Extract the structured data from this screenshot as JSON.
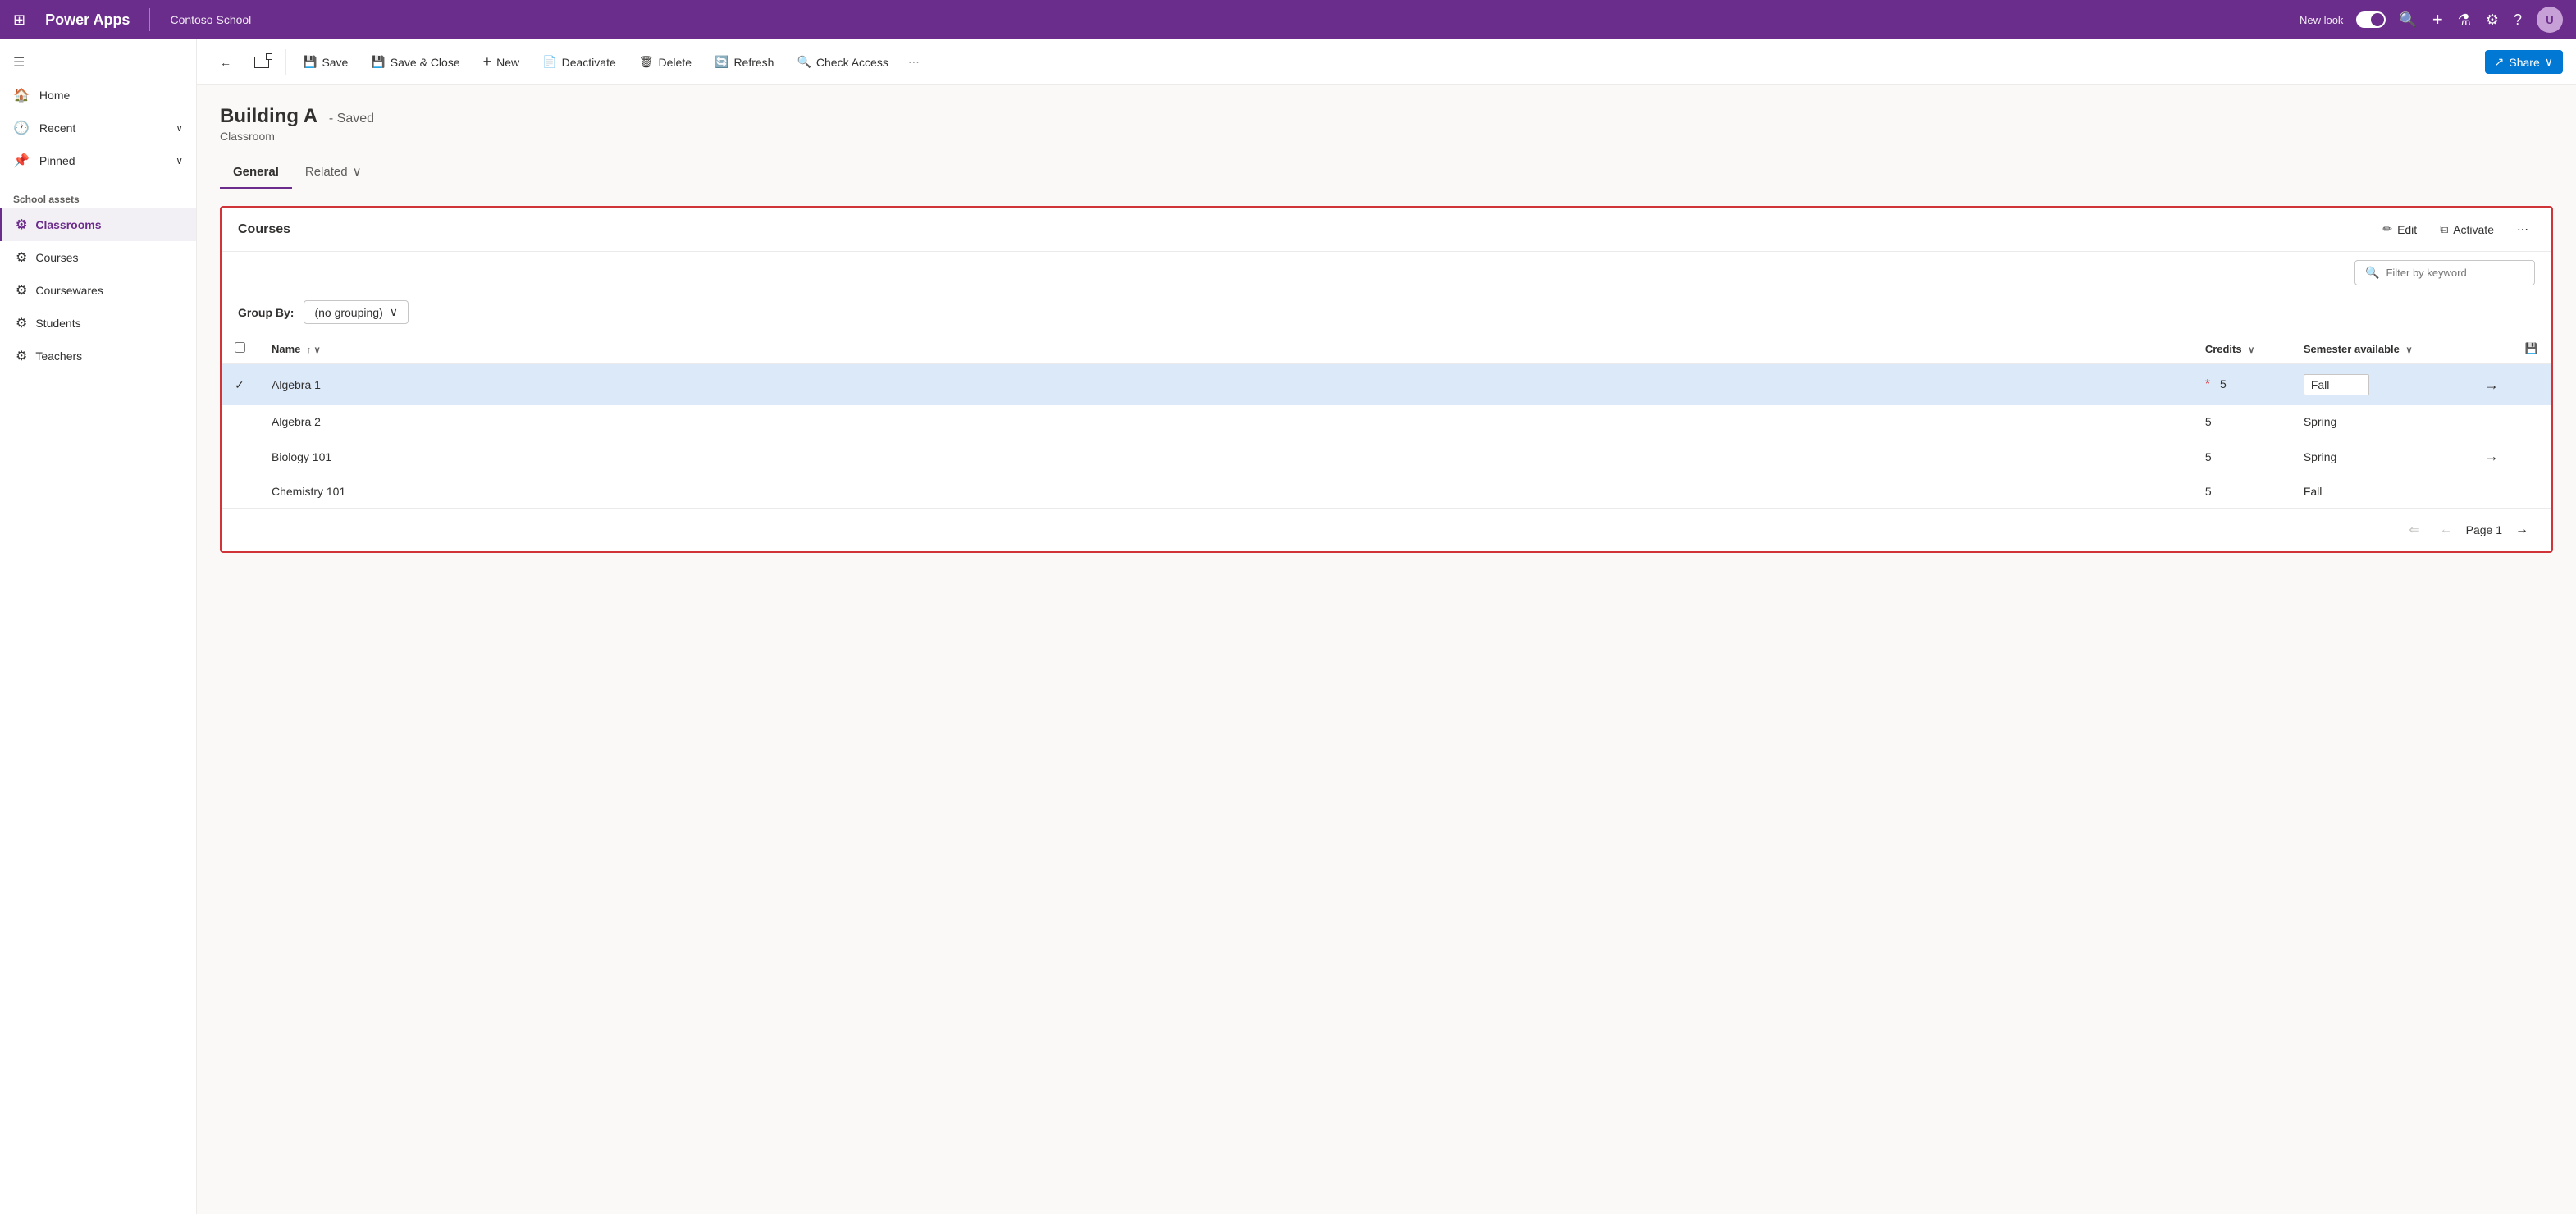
{
  "topnav": {
    "waffle": "⊞",
    "app_name": "Power Apps",
    "org_name": "Contoso School",
    "new_look_label": "New look",
    "search_icon": "🔍",
    "add_icon": "+",
    "filter_icon": "⚗",
    "settings_icon": "⚙",
    "help_icon": "?",
    "avatar_initials": "U"
  },
  "sidebar": {
    "menu_icon": "☰",
    "items_top": [
      {
        "label": "Home",
        "icon": "🏠"
      },
      {
        "label": "Recent",
        "icon": "🕐",
        "chevron": "∨"
      },
      {
        "label": "Pinned",
        "icon": "📌",
        "chevron": "∨"
      }
    ],
    "section_label": "School assets",
    "nav_items": [
      {
        "label": "Classrooms",
        "icon": "⚙",
        "active": true
      },
      {
        "label": "Courses",
        "icon": "⚙",
        "active": false
      },
      {
        "label": "Coursewares",
        "icon": "⚙",
        "active": false
      },
      {
        "label": "Students",
        "icon": "⚙",
        "active": false
      },
      {
        "label": "Teachers",
        "icon": "⚙",
        "active": false
      }
    ]
  },
  "toolbar": {
    "back_icon": "←",
    "open_icon": "⬜",
    "save_label": "Save",
    "save_close_label": "Save & Close",
    "new_label": "New",
    "deactivate_label": "Deactivate",
    "delete_label": "Delete",
    "refresh_label": "Refresh",
    "check_access_label": "Check Access",
    "more_icon": "⋯",
    "share_label": "Share"
  },
  "record": {
    "title": "Building A",
    "saved_text": "- Saved",
    "subtitle": "Classroom"
  },
  "tabs": [
    {
      "label": "General",
      "active": true
    },
    {
      "label": "Related",
      "active": false,
      "chevron": "∨"
    }
  ],
  "courses_panel": {
    "title": "Courses",
    "edit_label": "Edit",
    "activate_label": "Activate",
    "more_icon": "⋯",
    "edit_icon": "✏",
    "copy_icon": "⧉",
    "filter_placeholder": "Filter by keyword",
    "group_by_label": "Group By:",
    "group_by_value": "(no grouping)",
    "columns": [
      {
        "label": "Name",
        "sort": "↑ ∨"
      },
      {
        "label": "Credits",
        "sort": "∨"
      },
      {
        "label": "Semester available",
        "sort": "∨"
      }
    ],
    "rows": [
      {
        "selected": true,
        "name": "Algebra 1",
        "asterisk": true,
        "credits": 5,
        "semester": "Fall",
        "semester_editable": true,
        "has_nav": true
      },
      {
        "selected": false,
        "name": "Algebra 2",
        "asterisk": false,
        "credits": 5,
        "semester": "Spring",
        "semester_editable": false,
        "has_nav": false
      },
      {
        "selected": false,
        "name": "Biology 101",
        "asterisk": false,
        "credits": 5,
        "semester": "Spring",
        "semester_editable": false,
        "has_nav": true
      },
      {
        "selected": false,
        "name": "Chemistry 101",
        "asterisk": false,
        "credits": 5,
        "semester": "Fall",
        "semester_editable": false,
        "has_nav": false
      }
    ],
    "pagination": {
      "page_label": "Page 1",
      "first_icon": "⇐",
      "prev_icon": "←",
      "next_icon": "→",
      "save_icon": "💾"
    }
  },
  "colors": {
    "purple": "#6b2d8b",
    "red_border": "#d13438",
    "selected_row": "#dce9f8",
    "blue_button": "#0078d4"
  }
}
